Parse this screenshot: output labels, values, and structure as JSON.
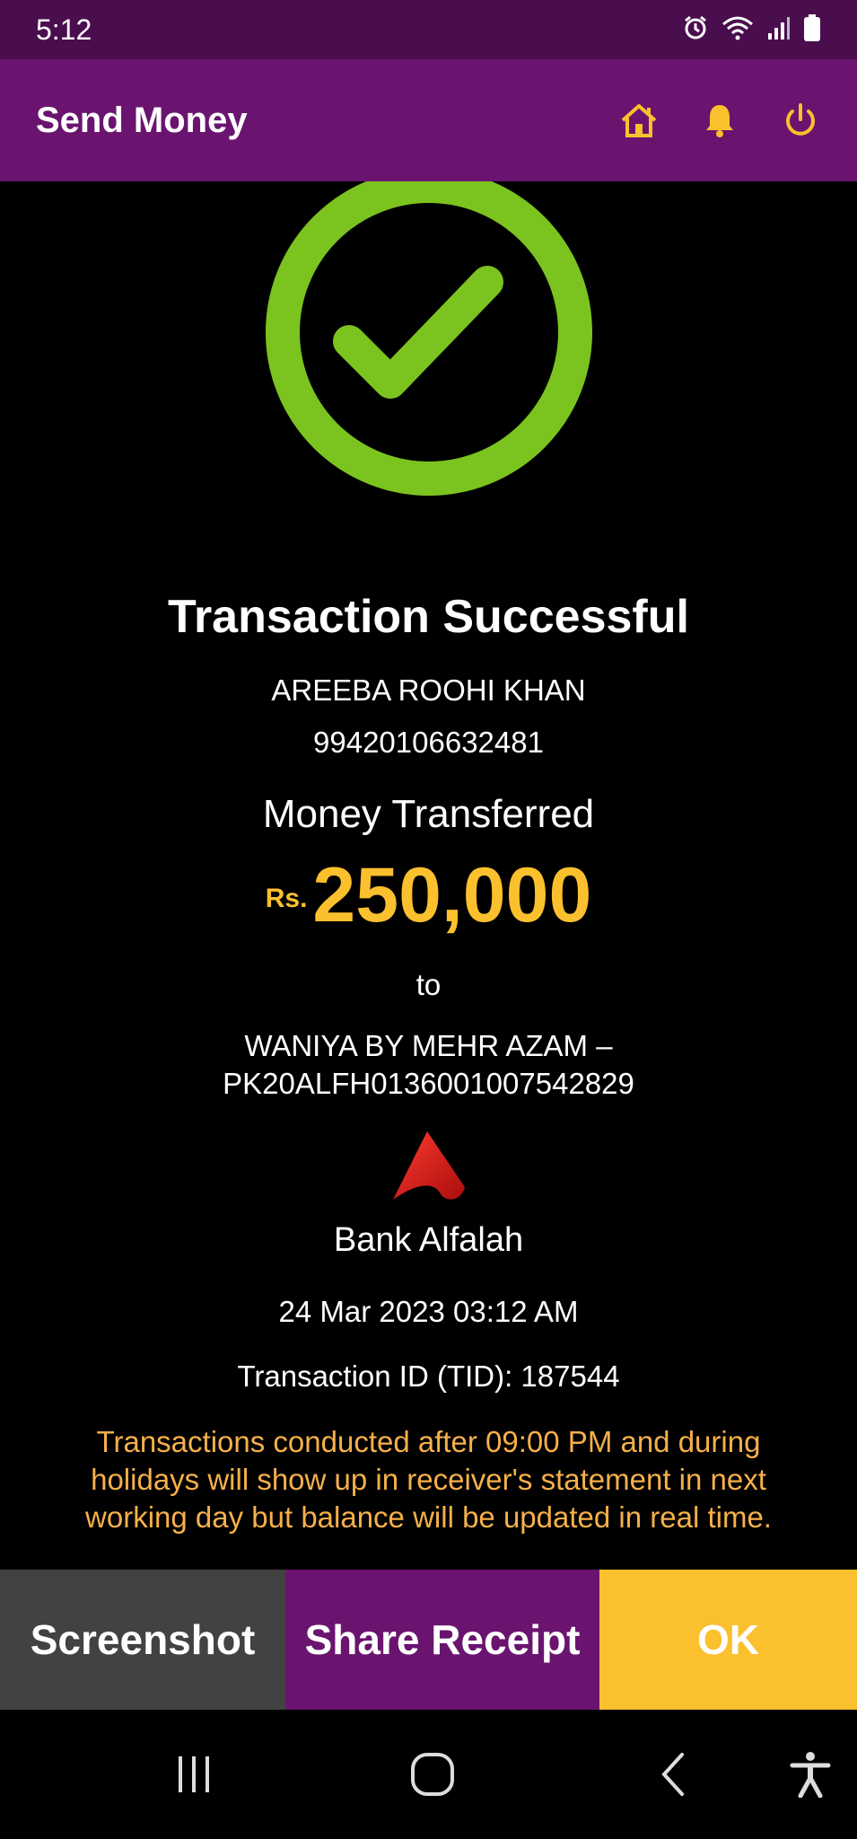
{
  "status_bar": {
    "time": "5:12",
    "icons": [
      "alarm-icon",
      "wifi-icon",
      "signal-icon",
      "battery-icon"
    ]
  },
  "app_bar": {
    "title": "Send Money",
    "actions": [
      "home-icon",
      "bell-icon",
      "power-icon"
    ],
    "accent_color": "#fbc02d",
    "background_color": "#6a1470"
  },
  "receipt": {
    "status_icon": "check-circle-icon",
    "status_color": "#7bc41f",
    "title": "Transaction Successful",
    "sender_name": "AREEBA ROOHI KHAN",
    "sender_account": "99420106632481",
    "money_label": "Money Transferred",
    "currency": "Rs.",
    "amount": "250,000",
    "to_label": "to",
    "recipient_name": "WANIYA BY MEHR AZAM –",
    "recipient_iban": "PK20ALFH0136001007542829",
    "bank_logo_icon": "bank-alfalah-logo-icon",
    "bank_name": "Bank Alfalah",
    "datetime": "24 Mar 2023 03:12 AM",
    "transaction_id": "Transaction ID (TID): 187544",
    "notice": "Transactions conducted after 09:00 PM and during holidays will show up in receiver's statement in next working day but balance will be updated in real time."
  },
  "actions": {
    "screenshot_label": "Screenshot",
    "share_label": "Share Receipt",
    "ok_label": "OK"
  },
  "nav_bar": {
    "items": [
      "recent-apps-icon",
      "home-circle-icon",
      "back-icon",
      "accessibility-icon"
    ]
  }
}
